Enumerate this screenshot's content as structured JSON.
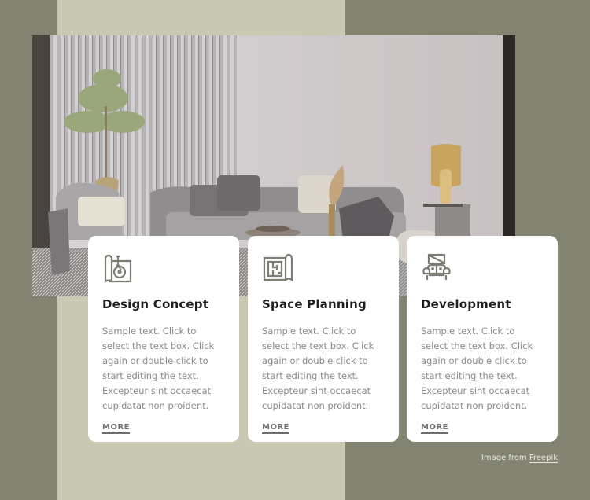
{
  "colors": {
    "background_dark": "#828371",
    "background_light": "#c9c9b3",
    "card_bg": "#ffffff",
    "heading": "#1e1e1e",
    "body_text": "#8a8a8a",
    "icon": "#7d7d73"
  },
  "hero_image": {
    "description": "Living room interior with grey sofa, armchair, plant, and gold lamp"
  },
  "cards": [
    {
      "icon": "design-blueprint-icon",
      "title": "Design Concept",
      "text": "Sample text. Click to select the text box. Click again or double click to start editing the text. Excepteur sint occaecat cupidatat non proident.",
      "more": "MORE"
    },
    {
      "icon": "floor-plan-icon",
      "title": "Space Planning",
      "text": "Sample text. Click to select the text box. Click again or double click to start editing the text. Excepteur sint occaecat cupidatat non proident.",
      "more": "MORE"
    },
    {
      "icon": "sofa-icon",
      "title": "Development",
      "text": "Sample text. Click to select the text box. Click again or double click to start editing the text. Excepteur sint occaecat cupidatat non proident.",
      "more": "MORE"
    }
  ],
  "credit": {
    "prefix": "Image from",
    "link": "Freepik"
  }
}
